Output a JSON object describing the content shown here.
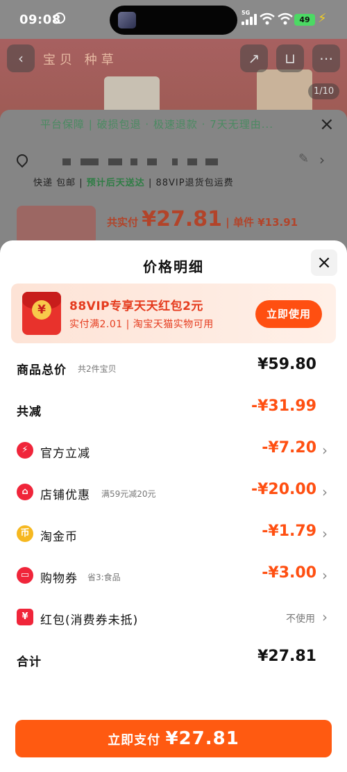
{
  "status_bar": {
    "time": "09:08",
    "network": "5G",
    "battery": "49"
  },
  "background": {
    "nav_title": "宝贝 种草",
    "image_counter": "1/10",
    "guarantee": "平台保障 | 破损包退 · 极速退款 · 7天无理由...",
    "shipping": "快递 包邮",
    "shipping_eta": "预计后天送达",
    "shipping_extra": "88VIP退货包运费",
    "paid_label": "共实付",
    "paid_amount": "¥27.81",
    "unit_price": "单件 ¥13.91"
  },
  "sheet": {
    "title": "价格明细",
    "promo": {
      "title": "88VIP专享天天红包2元",
      "subtitle": "实付满2.01 | 淘宝天猫实物可用",
      "button": "立即使用"
    },
    "rows": {
      "total": {
        "label": "商品总价",
        "note": "共2件宝贝",
        "value": "¥59.80"
      },
      "reduced": {
        "label": "共减",
        "value": "-¥31.99"
      },
      "official": {
        "label": "官方立减",
        "value": "-¥7.20"
      },
      "store": {
        "label": "店铺优惠",
        "note": "满59元减20元",
        "value": "-¥20.00"
      },
      "coins": {
        "label": "淘金币",
        "value": "-¥1.79"
      },
      "voucher": {
        "label": "购物券",
        "note": "省3:食品",
        "value": "-¥3.00"
      },
      "redpacket": {
        "label": "红包(消费券未抵)",
        "value": "不使用"
      },
      "sum": {
        "label": "合计",
        "value": "¥27.81"
      }
    },
    "pay_button": {
      "label": "立即支付",
      "amount": "¥27.81"
    }
  },
  "colors": {
    "accent": "#ff5a11",
    "promo_red": "#e53b1e",
    "official_icon": "#f0253a",
    "store_icon": "#f0253a",
    "coin_icon": "#f6b820",
    "voucher_icon": "#f0253a",
    "redpacket_icon": "#f0253a"
  }
}
